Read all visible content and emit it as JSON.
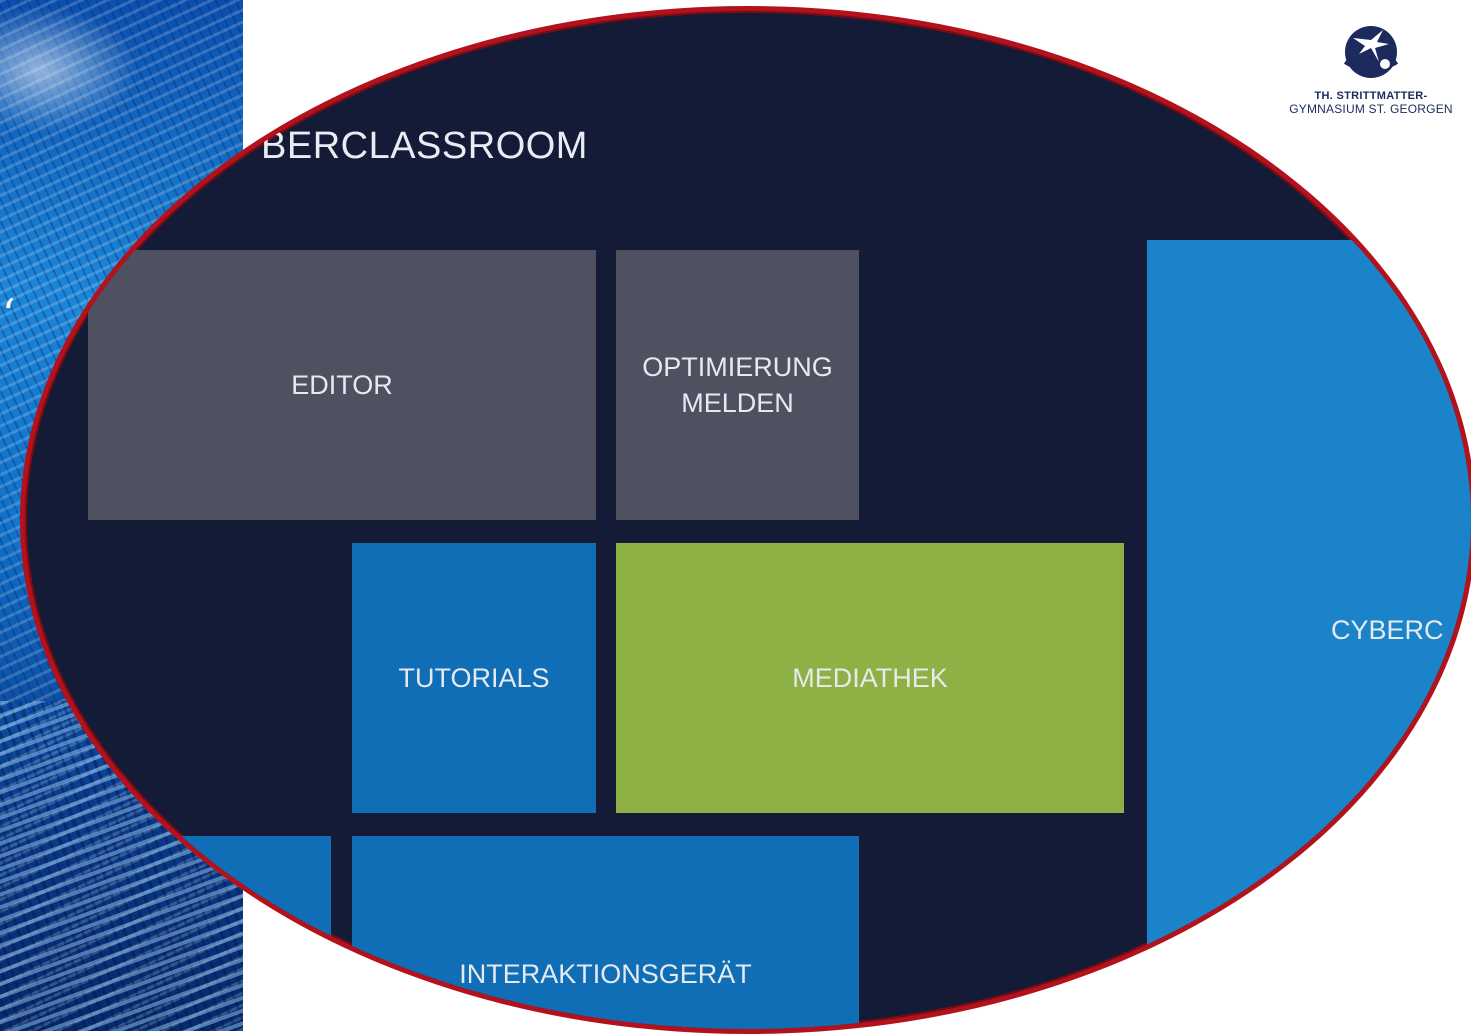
{
  "app": {
    "title": "BERCLASSROOM"
  },
  "tiles": {
    "editor": "EDITOR",
    "optimierung": "OPTIMIERUNG\nMELDEN",
    "tutorials": "TUTORIALS",
    "mediathek": "MEDIATHEK",
    "cyber": "CYBERC",
    "interaktion": "INTERAKTIONSGERÄT"
  },
  "logo": {
    "line1": "TH. STRITTMATTER-",
    "line2": "GYMNASIUM ST. GEORGEN"
  },
  "colors": {
    "frame_border": "#b3121d",
    "background": "#141b37",
    "tile_gray": "#4f5160",
    "tile_blue": "#0f6eb5",
    "tile_green": "#8db144"
  }
}
